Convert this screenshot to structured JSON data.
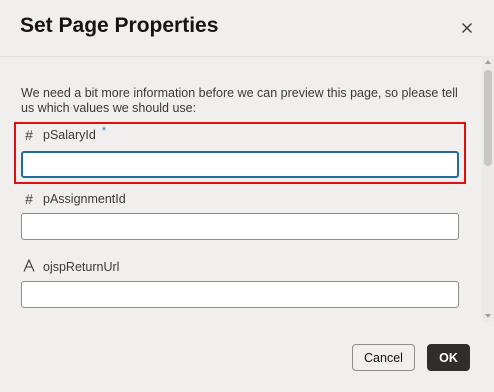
{
  "dialog": {
    "title": "Set Page Properties",
    "close_icon": "close-icon",
    "intro_text": "We need a bit more information before we can preview this page, so please tell us which values we should use:"
  },
  "fields": [
    {
      "label": "pSalaryId",
      "type_icon": "hash-icon",
      "required_marker": "*",
      "value": ""
    },
    {
      "label": "pAssignmentId",
      "type_icon": "hash-icon",
      "value": ""
    },
    {
      "label": "ojspReturnUrl",
      "type_icon": "text-type-icon",
      "value": ""
    }
  ],
  "footer": {
    "cancel_label": "Cancel",
    "ok_label": "OK"
  },
  "colors": {
    "highlight": "#e01010",
    "focus": "#216d99",
    "ok_button": "#312d2a",
    "required_marker": "#227fb5"
  }
}
